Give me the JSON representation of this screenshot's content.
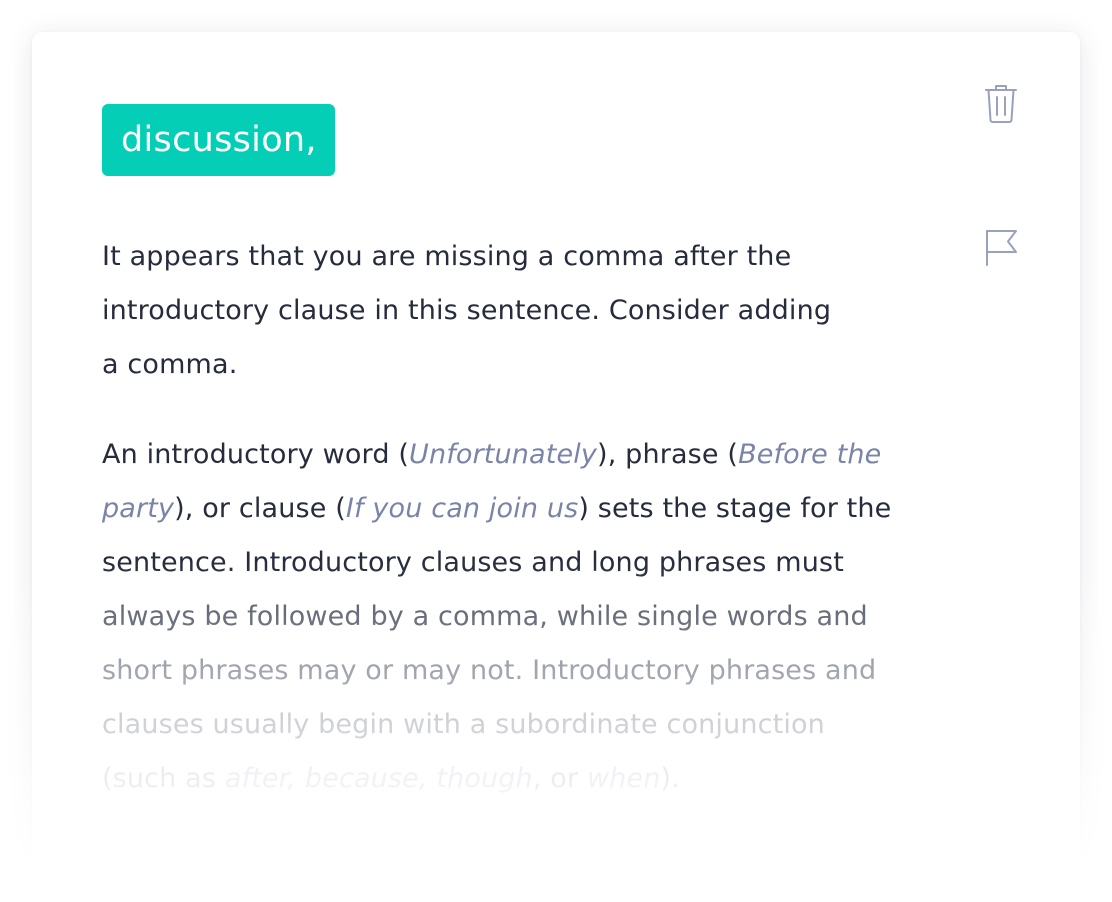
{
  "card": {
    "replacement": "discussion,",
    "actions": {
      "dismiss_icon": "trash-icon",
      "report_icon": "flag-icon"
    },
    "explanation": {
      "line1": "It appears that you are missing a comma after the",
      "line2": "introductory clause in this sentence. Consider adding",
      "line3": "a comma."
    },
    "details": {
      "l1": {
        "a": "An introductory word (",
        "ex1": "Unfortunately",
        "b": "), phrase (",
        "ex2": "Before the"
      },
      "l2": {
        "ex1": "party",
        "a": "), or clause (",
        "ex2": "If you can join us",
        "b": ") sets the stage for the"
      },
      "l3": "sentence. Introductory clauses and long phrases must",
      "l4": "always be followed by a comma, while single words and",
      "l5": "short phrases may or may not. Introductory phrases and",
      "l6": "clauses usually begin with a subordinate conjunction",
      "l7": {
        "a": "(such as ",
        "ex1": "after, because, though",
        "b": ", or ",
        "ex2": "when",
        "c": ")."
      }
    }
  },
  "colors": {
    "accent": "#04cfb6",
    "text": "#262c3c",
    "example": "#7a84a8",
    "icon": "#9aa1bd"
  }
}
